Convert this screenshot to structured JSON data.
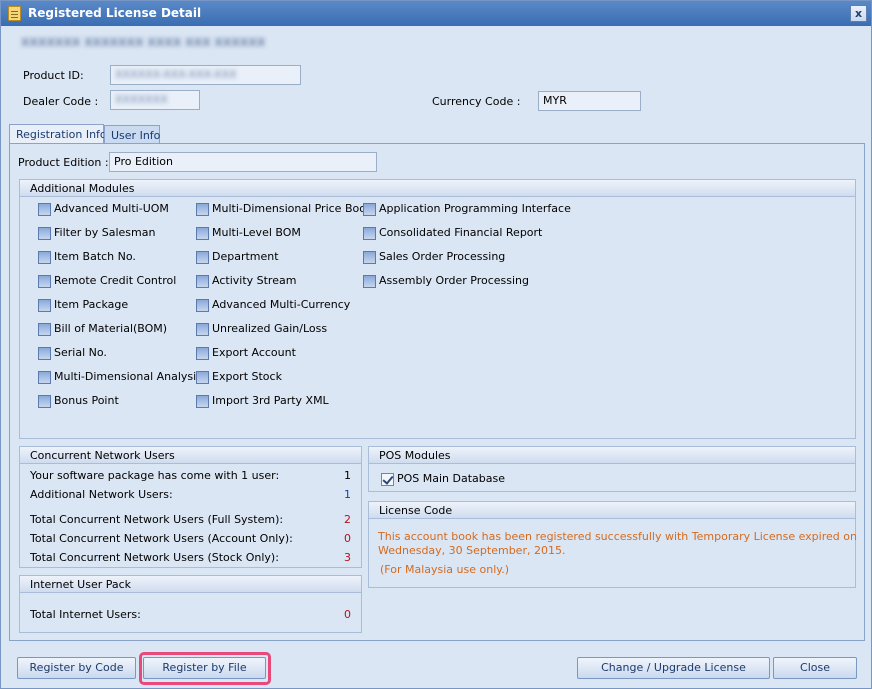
{
  "window": {
    "title": "Registered License Detail",
    "close_label": "x"
  },
  "header": {
    "company_name": "XXXXXXX XXXXXXX XXXX XXX XXXXXX",
    "product_id_label": "Product ID:",
    "product_id_value": "XXXXXX-XXX-XXX-XXX",
    "dealer_code_label": "Dealer Code :",
    "dealer_code_value": "XXXXXXX",
    "currency_code_label": "Currency Code :",
    "currency_code_value": "MYR"
  },
  "tabs": [
    {
      "label": "Registration Info",
      "active": true
    },
    {
      "label": "User Info",
      "active": false
    }
  ],
  "registration": {
    "product_edition_label": "Product Edition :",
    "product_edition_value": "Pro Edition"
  },
  "additional_modules": {
    "title": "Additional Modules",
    "col1": [
      "Advanced Multi-UOM",
      "Filter by Salesman",
      "Item Batch No.",
      "Remote Credit Control",
      "Item Package",
      "Bill of Material(BOM)",
      "Serial No.",
      "Multi-Dimensional Analysis",
      "Bonus Point"
    ],
    "col2": [
      "Multi-Dimensional Price Book",
      "Multi-Level BOM",
      "Department",
      "Activity Stream",
      "Advanced Multi-Currency",
      "Unrealized Gain/Loss",
      "Export Account",
      "Export Stock",
      "Import 3rd Party XML"
    ],
    "col3": [
      "Application Programming Interface",
      "Consolidated Financial Report",
      "Sales Order Processing",
      "Assembly Order Processing"
    ]
  },
  "concurrent_users": {
    "title": "Concurrent Network Users",
    "rows": [
      {
        "label": "Your software package has come with 1 user:",
        "value": "1"
      },
      {
        "label": "Additional Network Users:",
        "value": "1"
      },
      {
        "label": "Total Concurrent Network Users (Full System):",
        "value": "2"
      },
      {
        "label": "Total Concurrent Network Users (Account Only):",
        "value": "0"
      },
      {
        "label": "Total Concurrent Network Users (Stock Only):",
        "value": "3"
      }
    ]
  },
  "internet_user_pack": {
    "title": "Internet User Pack",
    "label": "Total Internet Users:",
    "value": "0"
  },
  "pos_modules": {
    "title": "POS Modules",
    "item": "POS Main Database",
    "checked": true
  },
  "license_code": {
    "title": "License Code",
    "line1": "This account book has been registered successfully with Temporary License expired on",
    "line2": "Wednesday, 30 September, 2015.",
    "line3": "(For Malaysia use only.)"
  },
  "buttons": {
    "register_by_code": "Register by Code",
    "register_by_file": "Register by File",
    "change_upgrade": "Change / Upgrade License",
    "close": "Close"
  },
  "colors": {
    "accent": "#3a6db2",
    "highlight": "#e6497a",
    "notice": "#d56a1e"
  }
}
